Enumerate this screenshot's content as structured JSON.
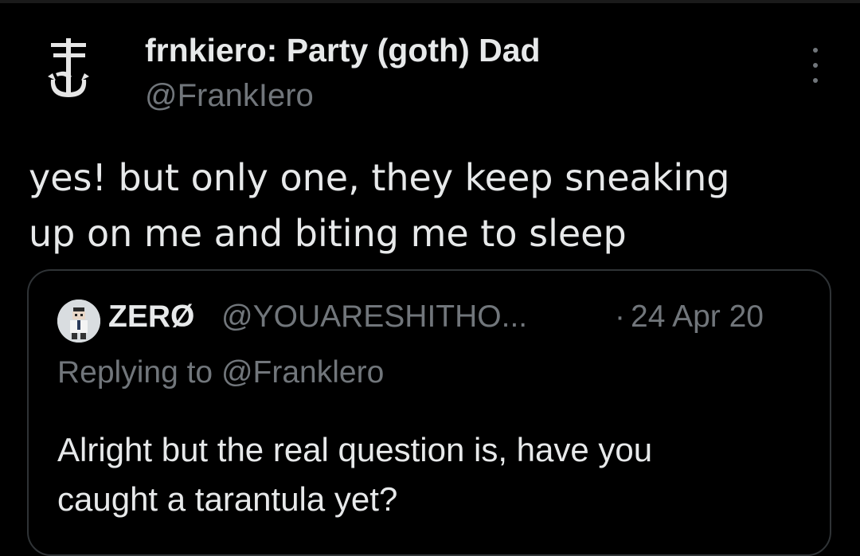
{
  "tweet": {
    "display_name": "frnkiero: Party (goth) Dad",
    "handle": "@FrankIero",
    "more_icon": "more-vertical-icon",
    "avatar_icon": "frank-iero-logo-icon",
    "text": "yes! but only one, they keep sneaking\nup on me and biting me to sleep"
  },
  "quote": {
    "display_name": "ZERØ",
    "handle": "@YOUARESHITHO...",
    "separator": "·",
    "date": "24 Apr 20",
    "replying_to": "Replying to @Franklero",
    "text": "Alright but the real question is, have you\ncaught a tarantula yet?"
  },
  "colors": {
    "background": "#000000",
    "primary_text": "#e7e9ea",
    "secondary_text": "#71767b",
    "card_border": "#2f3336"
  }
}
